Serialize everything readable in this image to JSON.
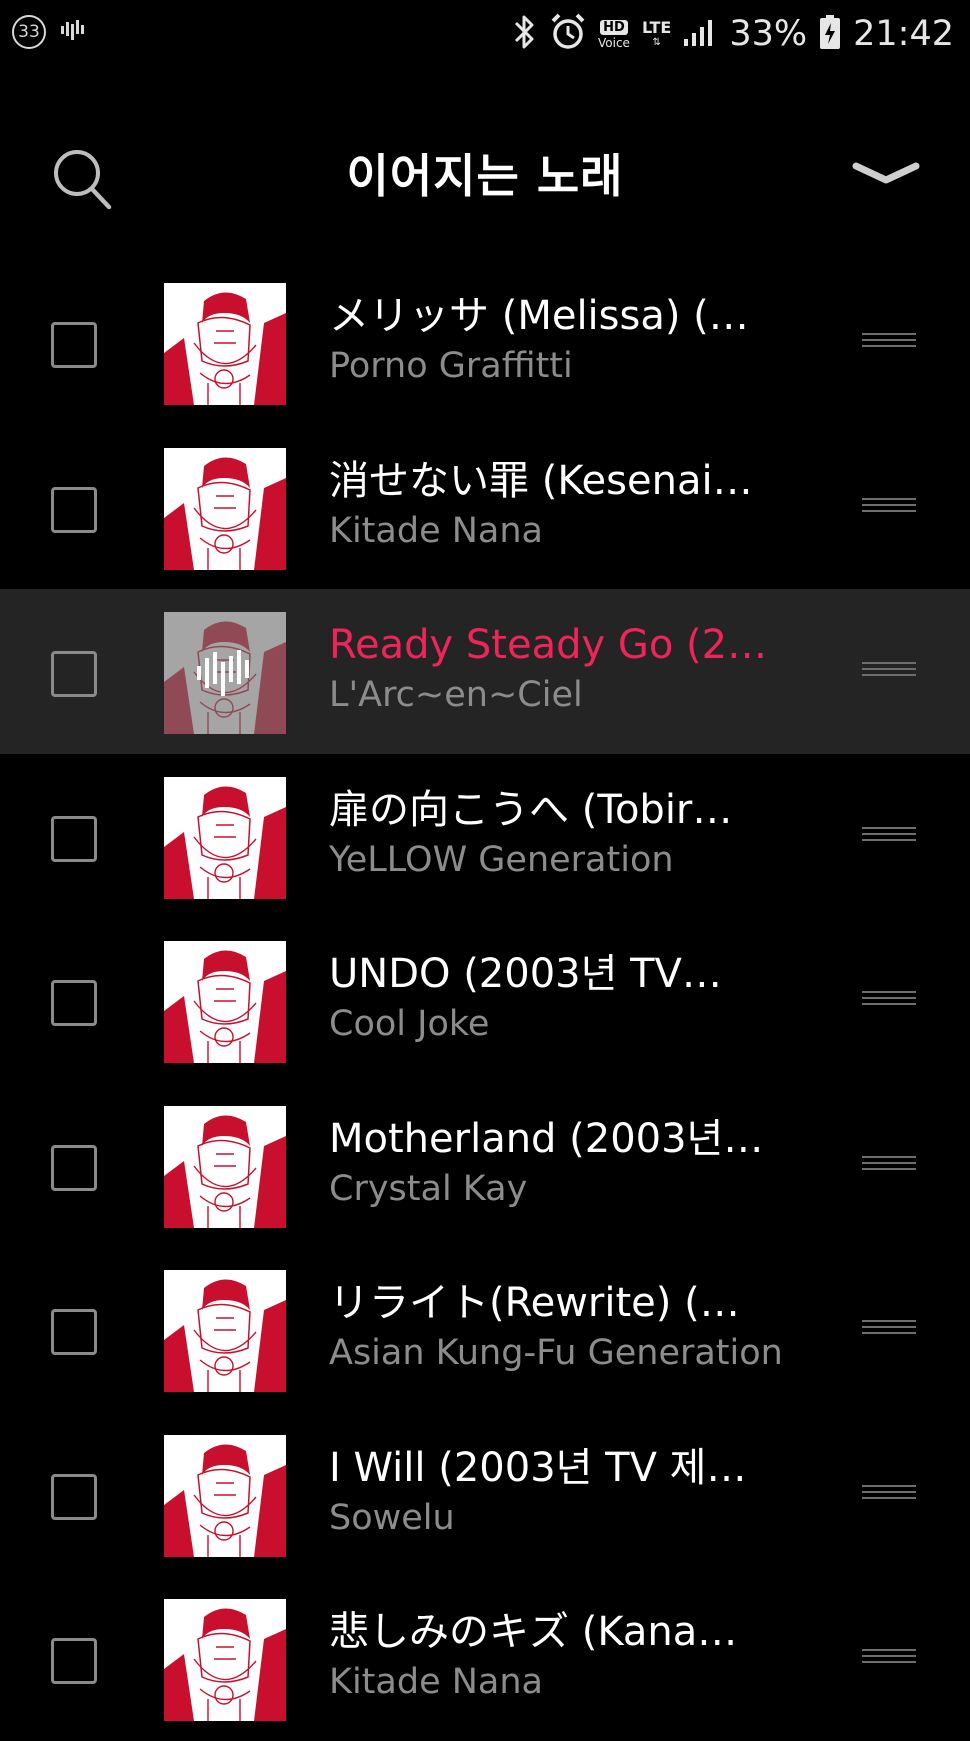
{
  "status_bar": {
    "notification_count": "33",
    "hd_label": "HD",
    "voice_label": "Voice",
    "network_type": "LTE",
    "battery": "33%",
    "time": "21:42"
  },
  "header": {
    "title": "이어지는 노래",
    "search_icon": "search-icon",
    "collapse_icon": "chevron-down-icon"
  },
  "colors": {
    "background": "#000000",
    "playing_row": "#242424",
    "accent": "#f0245a",
    "secondary_text": "#8c8c8c",
    "art_red": "#c8102e"
  },
  "queue": [
    {
      "title": "メリッサ (Melissa) (…",
      "artist": "Porno Graffitti",
      "playing": false
    },
    {
      "title": "消せない罪 (Kesenai…",
      "artist": "Kitade Nana",
      "playing": false
    },
    {
      "title": "Ready Steady Go (2…",
      "artist": "L'Arc~en~Ciel",
      "playing": true
    },
    {
      "title": "扉の向こうへ (Tobir…",
      "artist": "YeLLOW Generation",
      "playing": false
    },
    {
      "title": "UNDO (2003년 TV…",
      "artist": "Cool Joke",
      "playing": false
    },
    {
      "title": "Motherland (2003년…",
      "artist": "Crystal Kay",
      "playing": false
    },
    {
      "title": "リライト(Rewrite) (…",
      "artist": "Asian Kung-Fu Generation",
      "playing": false
    },
    {
      "title": "I Will (2003년 TV 제…",
      "artist": "Sowelu",
      "playing": false
    },
    {
      "title": "悲しみのキズ (Kana…",
      "artist": "Kitade Nana",
      "playing": false
    }
  ]
}
